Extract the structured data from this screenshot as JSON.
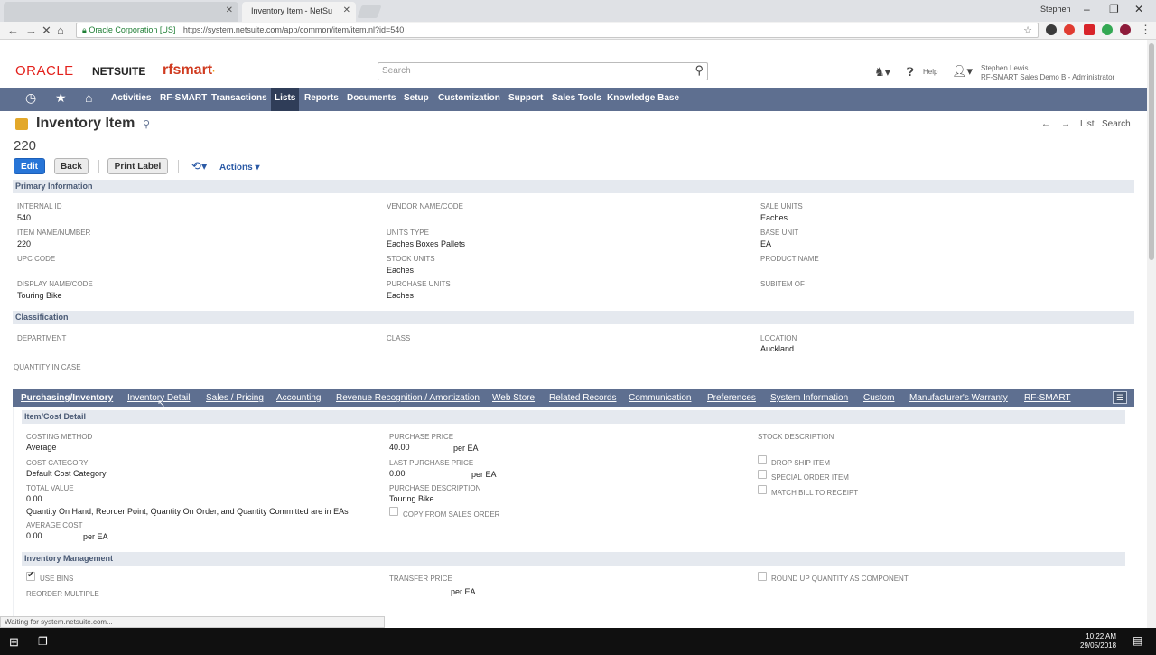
{
  "browser": {
    "tabs": [
      {
        "label": ""
      },
      {
        "label": "Inventory Item - NetSuite"
      }
    ],
    "profile": "Stephen",
    "security_label": "Oracle Corporation [US]",
    "url": "https://system.netsuite.com/app/common/item/item.nl?id=540"
  },
  "header": {
    "brand_oracle": "ORACLE",
    "brand_netsuite": "NETSUITE",
    "brand_rfsmart": "rfsmart",
    "search_placeholder": "Search",
    "help_label": "Help",
    "user_name": "Stephen Lewis",
    "user_role": "RF-SMART Sales Demo B - Administrator"
  },
  "menu": {
    "items": [
      "Activities",
      "RF-SMART",
      "Transactions",
      "Lists",
      "Reports",
      "Documents",
      "Setup",
      "Customization",
      "Support",
      "Sales Tools",
      "Knowledge Base"
    ],
    "active": "Lists"
  },
  "page": {
    "title": "Inventory Item",
    "record_number": "220",
    "nav_list": "List",
    "nav_search": "Search",
    "buttons": {
      "edit": "Edit",
      "back": "Back",
      "print_label": "Print Label",
      "actions": "Actions"
    }
  },
  "primary": {
    "header": "Primary Information",
    "internal_id_label": "INTERNAL ID",
    "internal_id": "540",
    "item_name_label": "ITEM NAME/NUMBER",
    "item_name": "220",
    "upc_label": "UPC CODE",
    "display_name_label": "DISPLAY NAME/CODE",
    "display_name": "Touring Bike",
    "vendor_label": "VENDOR NAME/CODE",
    "units_type_label": "UNITS TYPE",
    "units_type": "Eaches Boxes Pallets",
    "stock_units_label": "STOCK UNITS",
    "stock_units": "Eaches",
    "purchase_units_label": "PURCHASE UNITS",
    "purchase_units": "Eaches",
    "sale_units_label": "SALE UNITS",
    "sale_units": "Eaches",
    "base_unit_label": "BASE UNIT",
    "base_unit": "EA",
    "product_name_label": "PRODUCT NAME",
    "subitem_label": "SUBITEM OF"
  },
  "classification": {
    "header": "Classification",
    "department_label": "DEPARTMENT",
    "class_label": "CLASS",
    "location_label": "LOCATION",
    "location": "Auckland",
    "qty_in_case_label": "QUANTITY IN CASE"
  },
  "subtabs": {
    "items": [
      "Purchasing/Inventory",
      "Inventory Detail",
      "Sales / Pricing",
      "Accounting",
      "Revenue Recognition / Amortization",
      "Web Store",
      "Related Records",
      "Communication",
      "Preferences",
      "System Information",
      "Custom",
      "Manufacturer's Warranty",
      "RF-SMART"
    ],
    "active": "Purchasing/Inventory"
  },
  "item_cost": {
    "header": "Item/Cost Detail",
    "costing_method_label": "COSTING METHOD",
    "costing_method": "Average",
    "cost_category_label": "COST CATEGORY",
    "cost_category": "Default Cost Category",
    "total_value_label": "TOTAL VALUE",
    "total_value": "0.00",
    "qty_note": "Quantity On Hand, Reorder Point, Quantity On Order, and Quantity Committed are in EAs",
    "avg_cost_label": "AVERAGE COST",
    "avg_cost": "0.00",
    "avg_cost_unit": "per EA",
    "purchase_price_label": "PURCHASE PRICE",
    "purchase_price": "40.00",
    "purchase_price_unit": "per EA",
    "last_purchase_price_label": "LAST PURCHASE PRICE",
    "last_purchase_price": "0.00",
    "last_purchase_price_unit": "per EA",
    "purchase_desc_label": "PURCHASE DESCRIPTION",
    "purchase_desc": "Touring Bike",
    "copy_from_sales_label": "COPY FROM SALES ORDER",
    "stock_desc_label": "STOCK DESCRIPTION",
    "drop_ship_label": "DROP SHIP ITEM",
    "special_order_label": "SPECIAL ORDER ITEM",
    "match_bill_label": "MATCH BILL TO RECEIPT"
  },
  "inventory_mgmt": {
    "header": "Inventory Management",
    "use_bins_label": "USE BINS",
    "reorder_multiple_label": "REORDER MULTIPLE",
    "transfer_price_label": "TRANSFER PRICE",
    "transfer_price_unit": "per EA",
    "round_up_label": "ROUND UP QUANTITY AS COMPONENT"
  },
  "status_bar": "Waiting for system.netsuite.com...",
  "taskbar": {
    "time": "10:22 AM",
    "date": "29/05/2018"
  }
}
